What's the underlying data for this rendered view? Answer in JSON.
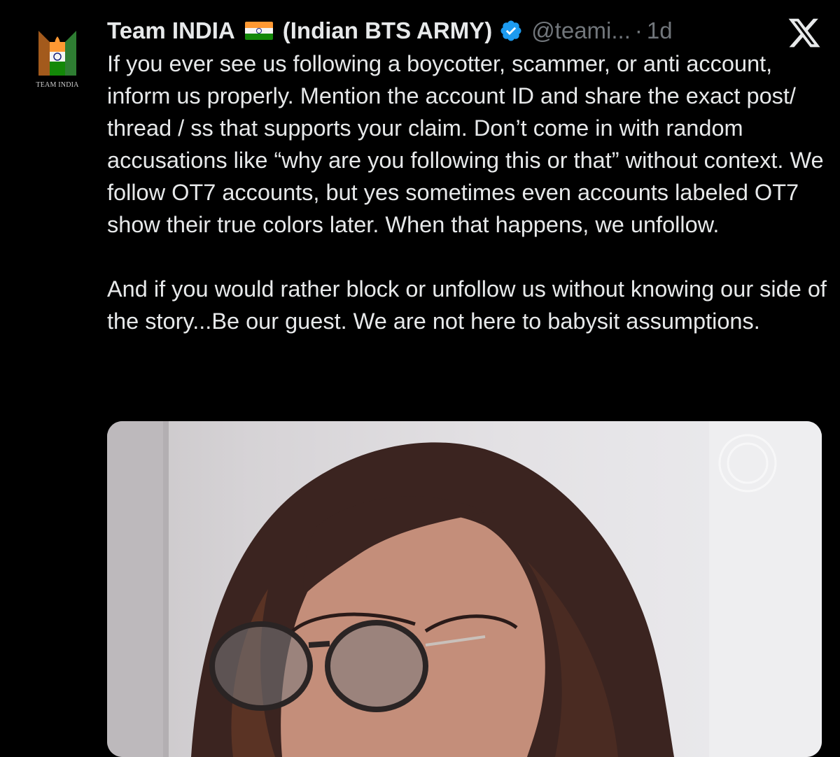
{
  "avatar": {
    "caption": "TEAM INDIA"
  },
  "tweet": {
    "display_name": "Team INDIA",
    "display_name_suffix": "(Indian BTS ARMY)",
    "handle": "@teami...",
    "separator": "·",
    "time": "1d",
    "paragraphs": [
      "If you ever see us following a boycotter, scammer, or anti account, inform us properly. Mention the account ID and share the exact post/ thread / ss that supports your claim. Don’t come in with random accusations like “why are you following this or that” without context. We follow OT7 accounts, but yes sometimes even accounts labeled OT7 show their true colors later. When that happens, we unfollow.",
      "And if you would rather block or unfollow us without knowing our side of the story...Be our guest. We are not here to babysit assumptions."
    ]
  },
  "icons": {
    "flag": "india-flag-icon",
    "verified": "verified-badge-icon",
    "x_logo": "x-logo-icon"
  },
  "colors": {
    "background": "#000000",
    "text": "#e7e9ea",
    "secondary": "#71767b",
    "verified": "#1d9bf0"
  }
}
